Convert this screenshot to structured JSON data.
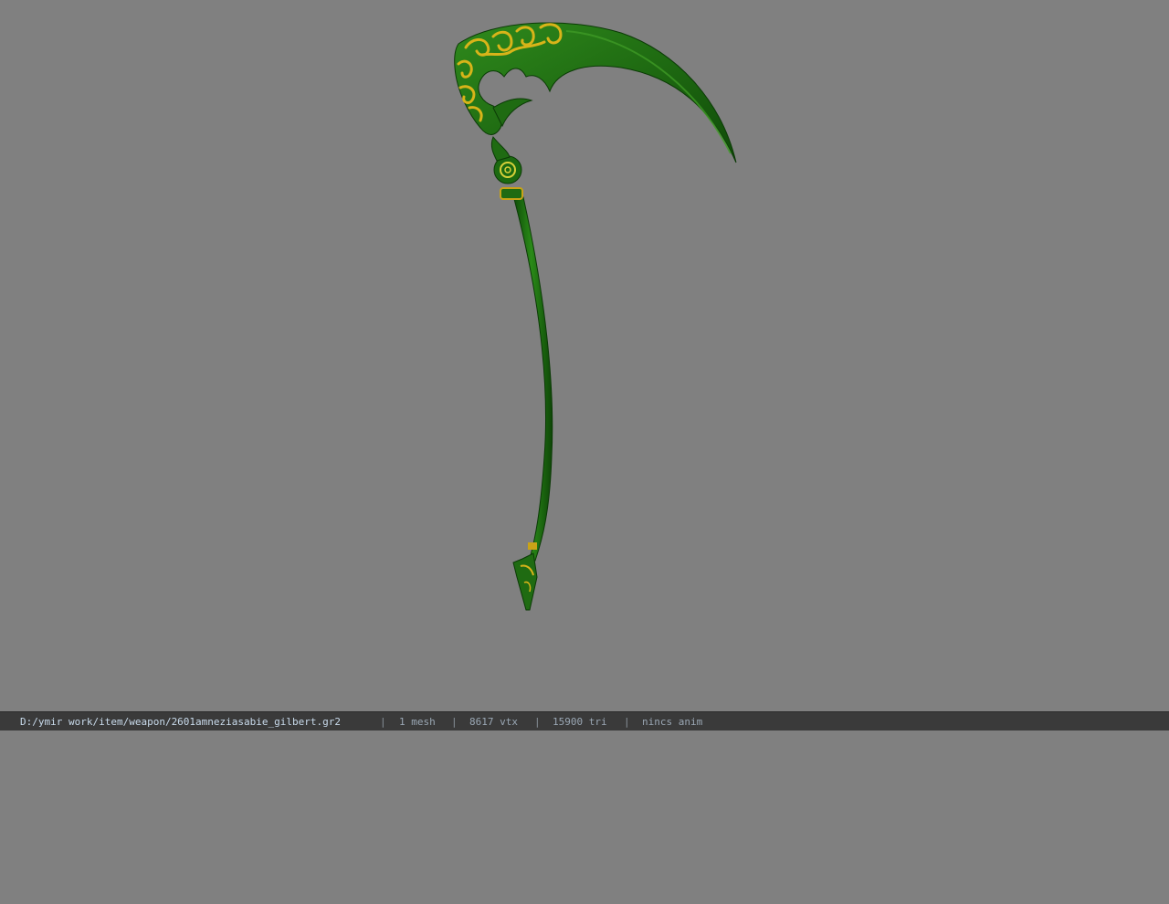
{
  "viewer": {
    "background_color": "#808080",
    "model": {
      "icon": "scythe-model",
      "blade_color": "#1f6b12",
      "blade_highlight_color": "#3f9a25",
      "ornament_color": "#d8b419",
      "shaft_color": "#1b6a10"
    }
  },
  "status_bar": {
    "file_path": "D:/ymir work/item/weapon/2601amneziasabie_gilbert.gr2",
    "separator": "|",
    "mesh_count": "1 mesh",
    "vertex_count": "8617 vtx",
    "triangle_count": "15900 tri",
    "animation": "nincs anim"
  }
}
